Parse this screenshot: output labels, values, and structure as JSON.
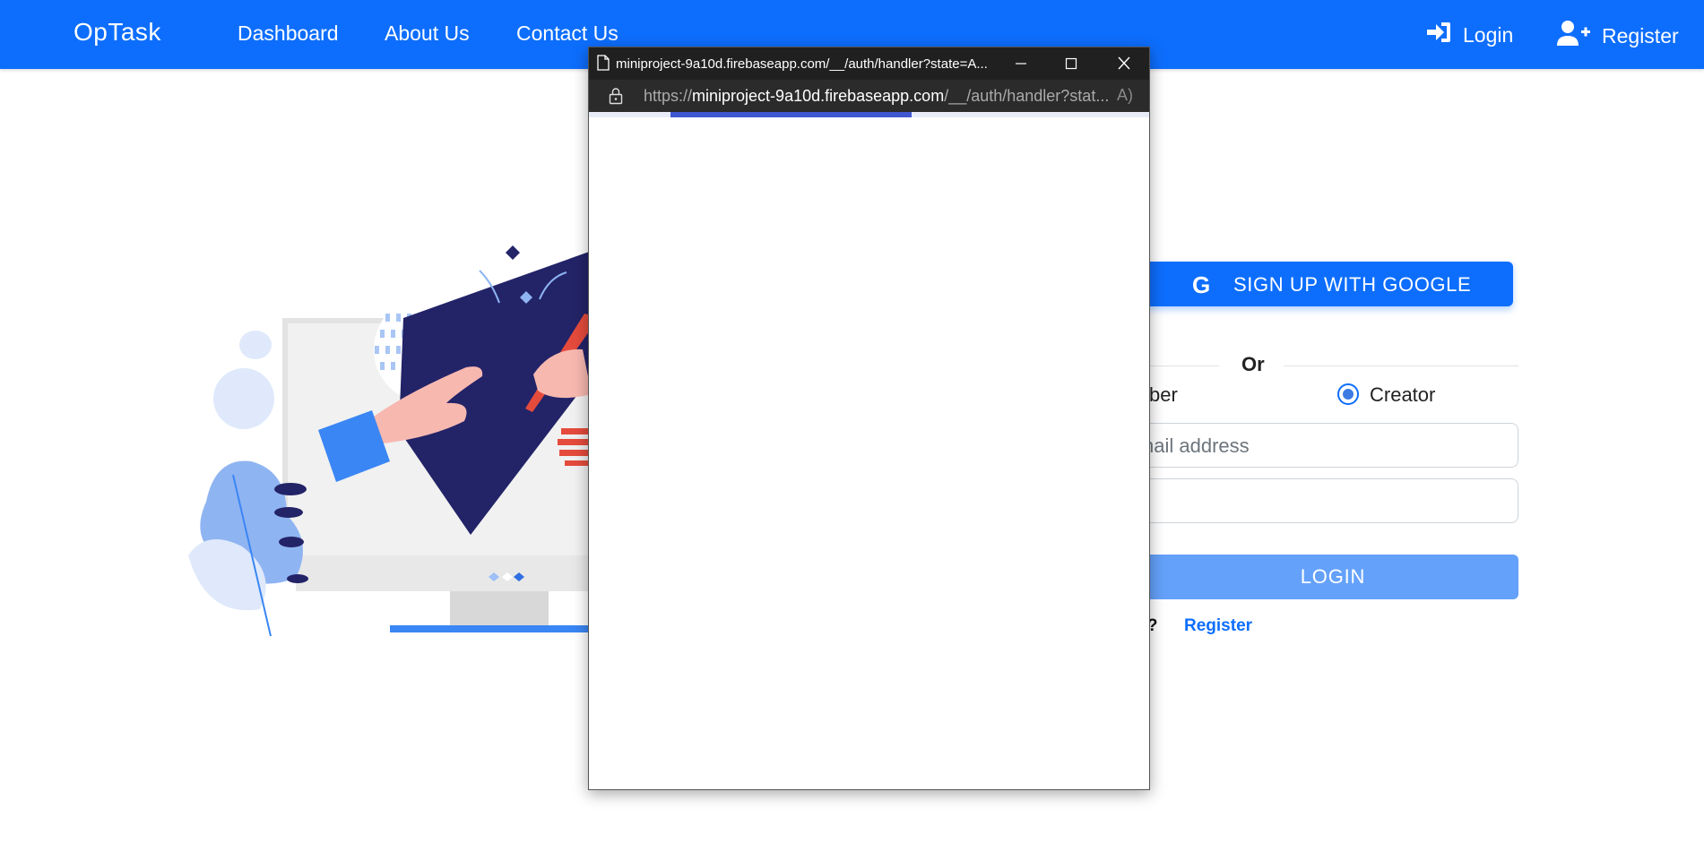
{
  "navbar": {
    "brand": "OpTask",
    "links": [
      "Dashboard",
      "About Us",
      "Contact Us"
    ],
    "login_label": "Login",
    "register_label": "Register",
    "background": "#0d6efd"
  },
  "form": {
    "google_button_label": "SIGN UP WITH GOOGLE",
    "or_label": "Or",
    "role_member_partial": "ber",
    "role_creator": "Creator",
    "selected_role": "Creator",
    "email_placeholder_partial": "nail address",
    "login_button_label": "LOGIN",
    "account_prompt_partial": "nt?",
    "register_link": "Register"
  },
  "popup": {
    "title": "miniproject-9a10d.firebaseapp.com/__/auth/handler?state=A...",
    "url_scheme": "https://",
    "url_host": "miniproject-9a10d.firebaseapp.com",
    "url_path": "/__/auth/handler?stat...",
    "reader_icon_label": "A",
    "loading_progress_percent": 43
  },
  "icons": {
    "login": "sign-in-icon",
    "register": "user-plus-icon",
    "google": "google-icon",
    "document": "document-icon",
    "lock": "lock-icon",
    "minimize": "minimize-icon",
    "maximize": "maximize-icon",
    "close": "close-icon"
  },
  "colors": {
    "primary": "#0d6efd",
    "login_button": "#64a1fa",
    "illustration_navy": "#232368",
    "illustration_red": "#e54b3c"
  }
}
